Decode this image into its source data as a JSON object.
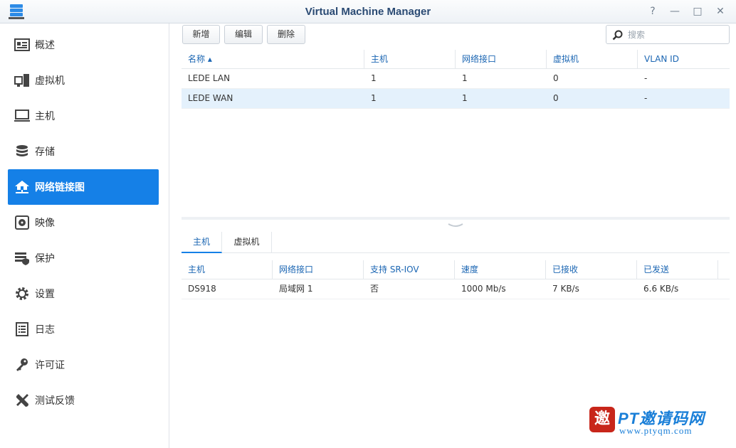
{
  "window": {
    "title": "Virtual Machine Manager",
    "buttons": [
      "?",
      "—",
      "□",
      "✕"
    ]
  },
  "sidebar": {
    "items": [
      {
        "label": "概述",
        "icon": "overview-icon"
      },
      {
        "label": "虚拟机",
        "icon": "vm-icon"
      },
      {
        "label": "主机",
        "icon": "host-icon"
      },
      {
        "label": "存储",
        "icon": "storage-icon"
      },
      {
        "label": "网络链接图",
        "icon": "network-icon",
        "active": true
      },
      {
        "label": "映像",
        "icon": "image-icon"
      },
      {
        "label": "保护",
        "icon": "protection-icon"
      },
      {
        "label": "设置",
        "icon": "settings-icon"
      },
      {
        "label": "日志",
        "icon": "log-icon"
      },
      {
        "label": "许可证",
        "icon": "license-icon"
      },
      {
        "label": "测试反馈",
        "icon": "feedback-icon"
      }
    ]
  },
  "toolbar": {
    "add_label": "新增",
    "edit_label": "编辑",
    "delete_label": "删除",
    "search_placeholder": "搜索"
  },
  "network_table": {
    "columns": [
      "名称 ▴",
      "主机",
      "网络接口",
      "虚拟机",
      "VLAN ID"
    ],
    "rows": [
      [
        "LEDE LAN",
        "1",
        "1",
        "0",
        "-"
      ],
      [
        "LEDE WAN",
        "1",
        "1",
        "0",
        "-"
      ]
    ],
    "selected_row": 1
  },
  "detail_tabs": {
    "tabs": [
      "主机",
      "虚拟机"
    ],
    "active": 0
  },
  "host_table": {
    "columns": [
      "主机",
      "网络接口",
      "支持 SR-IOV",
      "速度",
      "已接收",
      "已发送"
    ],
    "rows": [
      [
        "DS918",
        "局域网 1",
        "否",
        "1000 Mb/s",
        "7 KB/s",
        "6.6 KB/s"
      ]
    ]
  },
  "watermark": {
    "badge": "邀",
    "text": "PT邀请码网",
    "url": "www.ptyqm.com"
  },
  "colors": {
    "accent": "#1580e7",
    "header_text": "#1b66b3",
    "selected_row": "#e4f1fc"
  }
}
